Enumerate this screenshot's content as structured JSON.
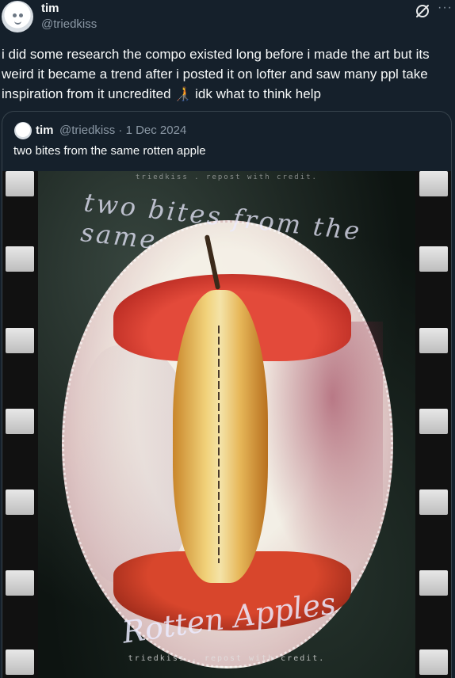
{
  "post": {
    "author_name": "tim",
    "author_handle": "@triedkiss",
    "text": "i did some research the compo existed long before i made the art but its weird it became a trend after i posted it on lofter and saw many ppl take inspiration from it uncredited 🧑‍🦯 idk what to think help",
    "more_label": "···"
  },
  "quoted_post": {
    "author_name": "tim",
    "meta": "@triedkiss · 1 Dec 2024",
    "text": "two bites from the same rotten apple",
    "artwork": {
      "watermark_top": "triedkiss . repost with credit.",
      "script_top": "two bites from the same",
      "script_bottom": "Rotten Apples",
      "watermark_bottom": "triedkiss . repost with credit."
    }
  }
}
